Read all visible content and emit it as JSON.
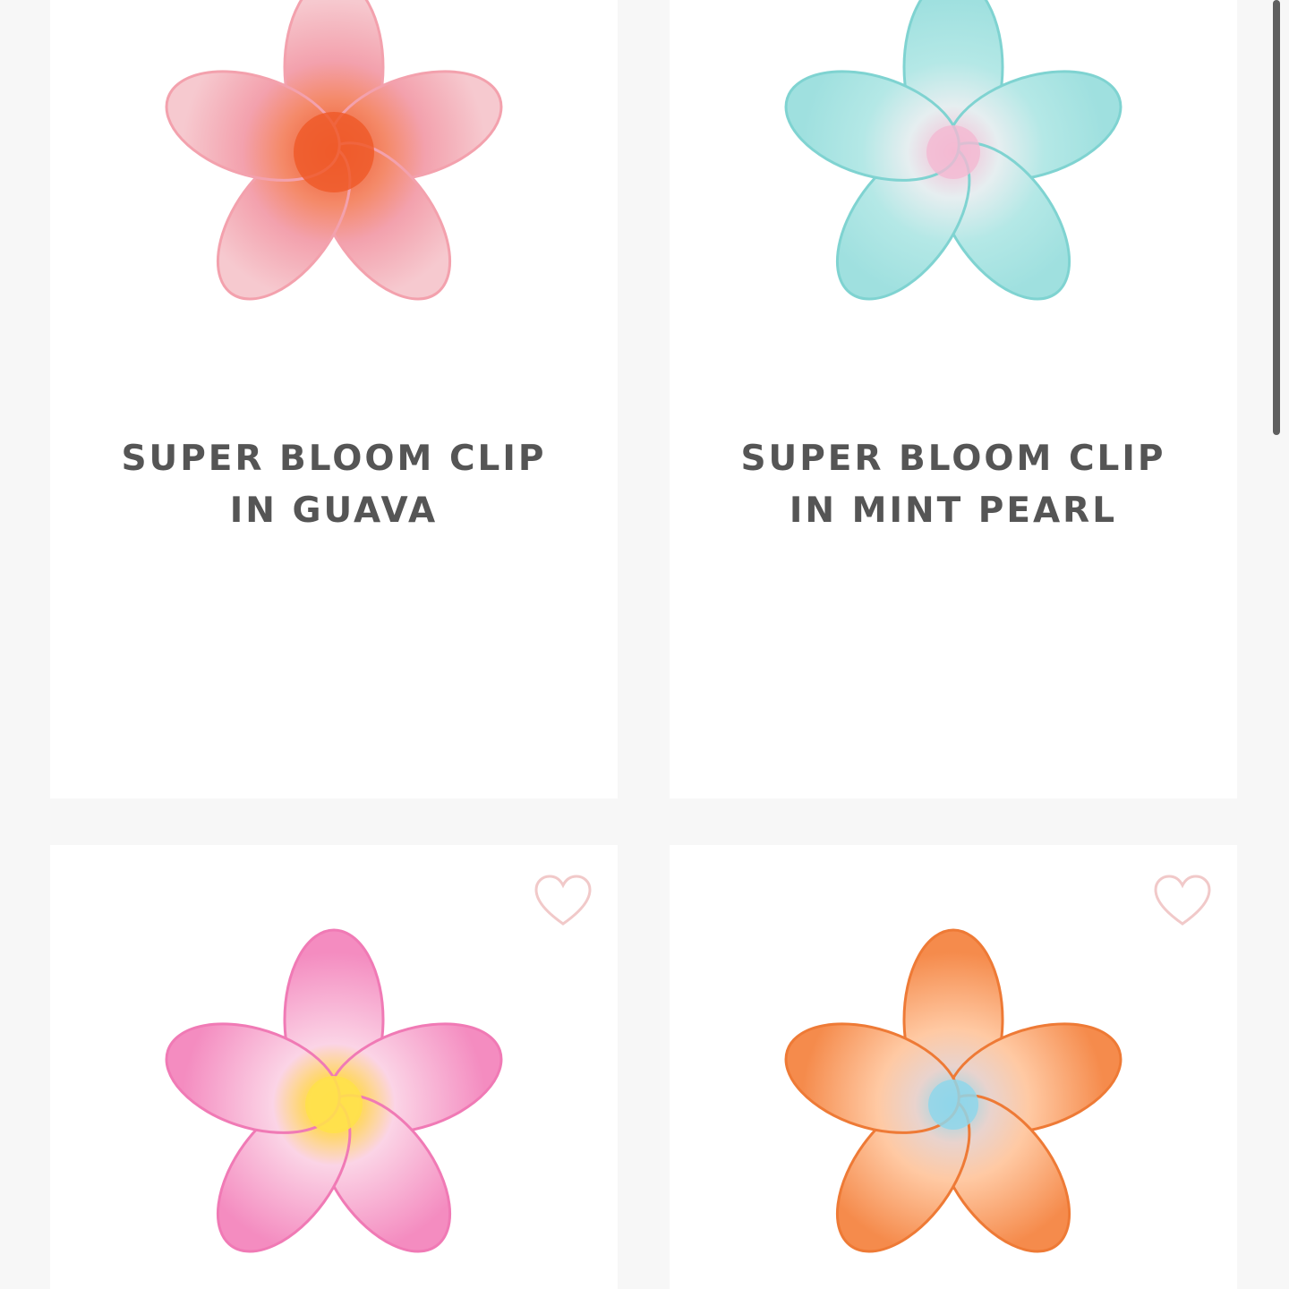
{
  "products": [
    {
      "title_line1": "SUPER BLOOM CLIP",
      "title_line2": "IN GUAVA",
      "colors": {
        "petal_light": "#f6c9cf",
        "petal_mid": "#f3a1ad",
        "center": "#ef5a2a"
      },
      "image_icon": "flower-claw-clip"
    },
    {
      "title_line1": "SUPER BLOOM CLIP",
      "title_line2": "IN MINT PEARL",
      "colors": {
        "petal_light": "#d4f3f2",
        "petal_mid": "#9fe0df",
        "center": "#f4b9d2"
      },
      "image_icon": "flower-claw-clip"
    },
    {
      "colors": {
        "petal_light": "#fbd4e6",
        "petal_mid": "#f48cc0",
        "center": "#ffe14a"
      },
      "image_icon": "flower-claw-clip",
      "wishlist_icon": "heart-outline-icon"
    },
    {
      "colors": {
        "petal_light": "#ffc9a3",
        "petal_mid": "#f58b4c",
        "center": "#8fd6ea"
      },
      "image_icon": "flower-claw-clip",
      "wishlist_icon": "heart-outline-icon"
    }
  ],
  "theme": {
    "page_background": "#f7f7f7",
    "card_background": "#ffffff",
    "title_color": "#555555",
    "heart_color": "#f1c9c9"
  }
}
